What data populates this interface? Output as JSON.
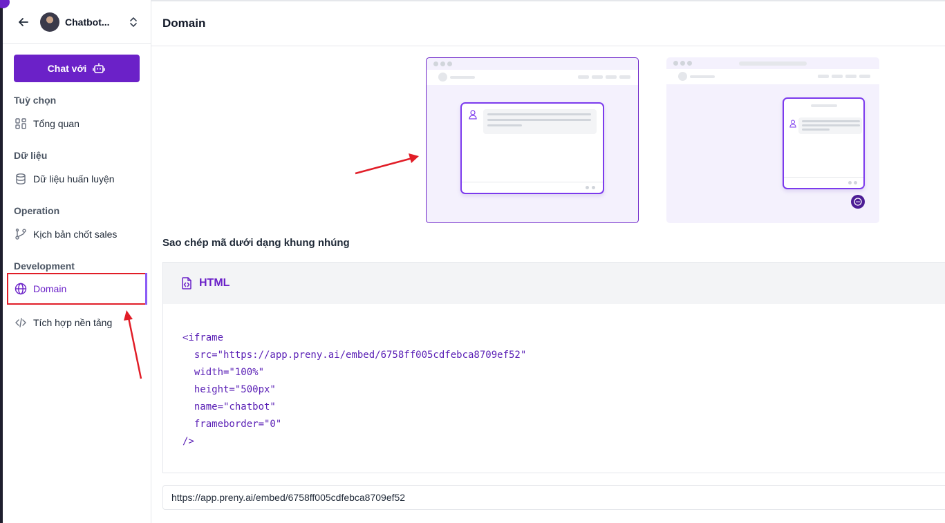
{
  "sidebar": {
    "bot_name": "Chatbot...",
    "chat_button_label": "Chat với",
    "sections": [
      {
        "label": "Tuỳ chọn",
        "items": [
          {
            "label": "Tổng quan",
            "icon": "grid-icon"
          }
        ]
      },
      {
        "label": "Dữ liệu",
        "items": [
          {
            "label": "Dữ liệu huấn luyện",
            "icon": "database-icon"
          }
        ]
      },
      {
        "label": "Operation",
        "items": [
          {
            "label": "Kịch bản chốt sales",
            "icon": "branch-icon"
          }
        ]
      },
      {
        "label": "Development",
        "items": [
          {
            "label": "Domain",
            "icon": "globe-icon",
            "active": true
          },
          {
            "label": "Tích hợp nền tảng",
            "icon": "code-icon"
          }
        ]
      }
    ]
  },
  "main": {
    "title": "Domain",
    "embed_title": "Sao chép mã dưới dạng khung nhúng",
    "code_tab_label": "HTML",
    "code_snippet": "<iframe\n  src=\"https://app.preny.ai/embed/6758ff005cdfebca8709ef52\"\n  width=\"100%\"\n  height=\"500px\"\n  name=\"chatbot\"\n  frameborder=\"0\"\n/>",
    "embed_url": "https://app.preny.ai/embed/6758ff005cdfebca8709ef52"
  },
  "colors": {
    "accent": "#6b21c8",
    "annotation_red": "#e11d27",
    "preview_bg": "#f4f1fd"
  }
}
